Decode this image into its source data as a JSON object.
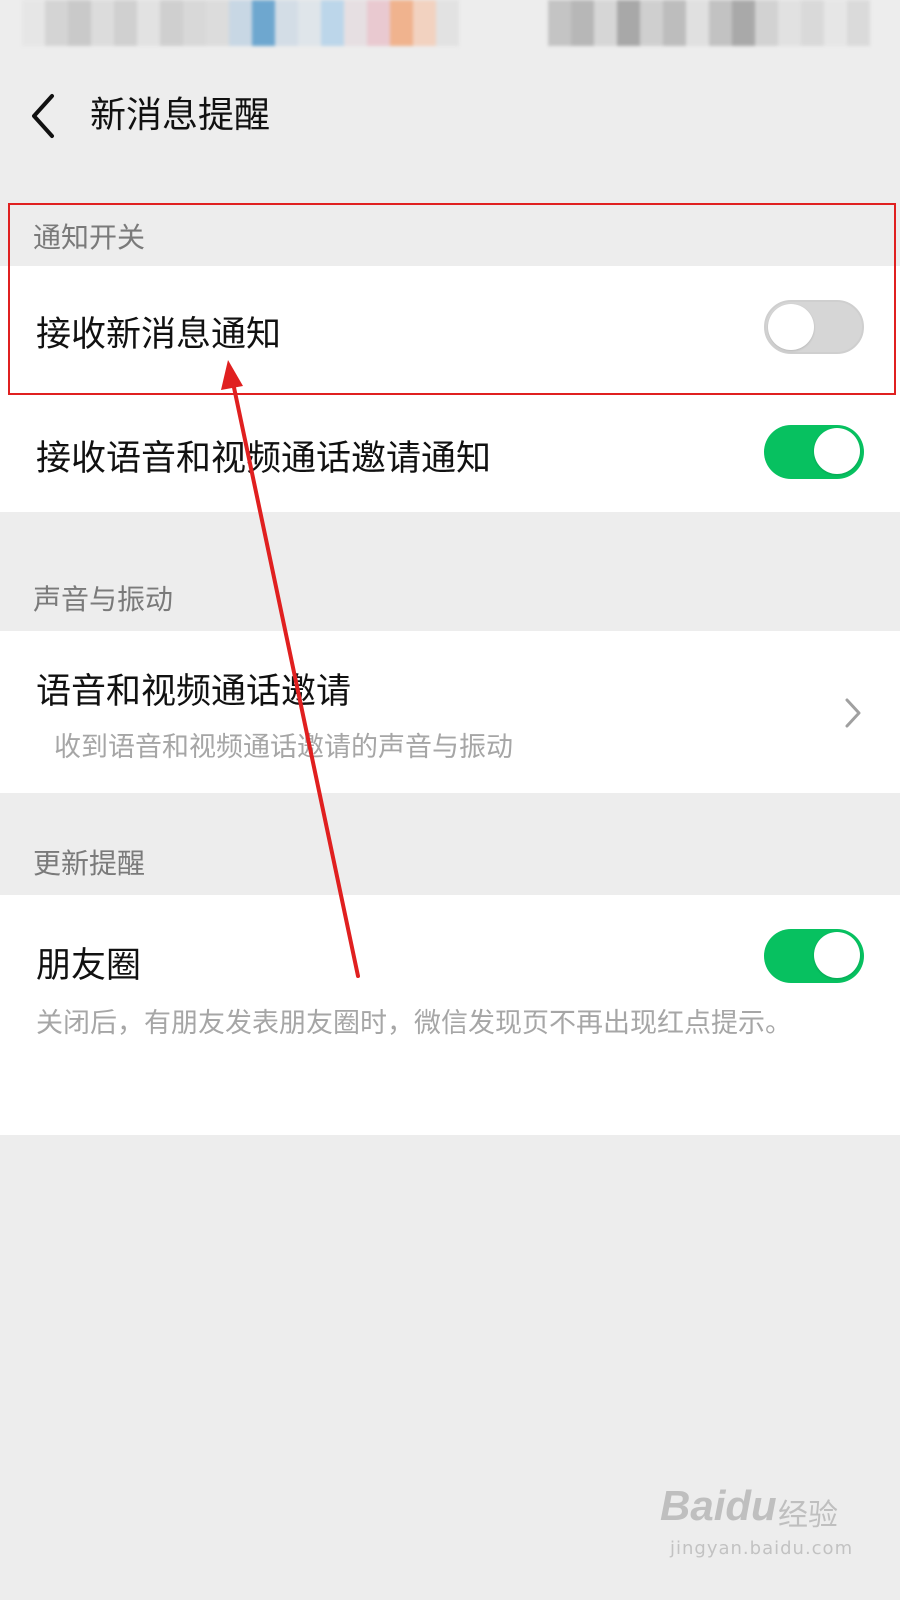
{
  "header": {
    "title": "新消息提醒"
  },
  "sections": {
    "notify_switch": {
      "label": "通知开关",
      "receive_new_message": {
        "label": "接收新消息通知",
        "enabled": false
      },
      "receive_call_invite": {
        "label": "接收语音和视频通话邀请通知",
        "enabled": true
      }
    },
    "sound_vibration": {
      "label": "声音与振动",
      "call_invite": {
        "label": "语音和视频通话邀请",
        "description": "收到语音和视频通话邀请的声音与振动"
      }
    },
    "update_reminder": {
      "label": "更新提醒",
      "moments": {
        "label": "朋友圈",
        "enabled": true,
        "description": "关闭后，有朋友发表朋友圈时，微信发现页不再出现红点提示。"
      }
    }
  },
  "colors": {
    "accent_green": "#07c160",
    "annotation_red": "#e02020",
    "background": "#ededed"
  },
  "watermark": {
    "brand": "Baidu",
    "sub": "经验",
    "url": "jingyan.baidu.com"
  }
}
